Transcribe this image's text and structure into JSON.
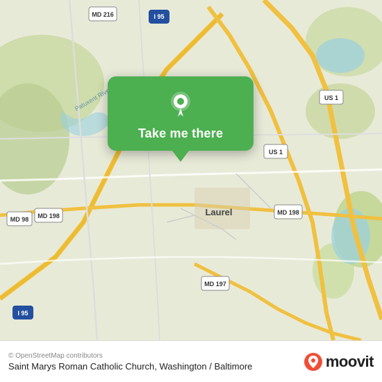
{
  "map": {
    "attribution": "© OpenStreetMap contributors",
    "background_color": "#e8f0d8"
  },
  "popup": {
    "label": "Take me there",
    "pin_icon": "location-pin"
  },
  "bottom_bar": {
    "place_name": "Saint Marys Roman Catholic Church, Washington / Baltimore",
    "moovit_text": "moovit",
    "attribution": "© OpenStreetMap contributors"
  }
}
